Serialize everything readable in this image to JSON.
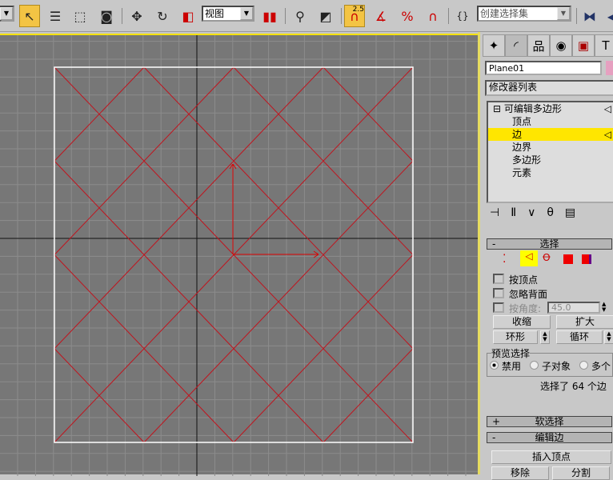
{
  "toolbar": {
    "view_select": "视图",
    "selection_set": "创建选择集",
    "snap_value": "2.5",
    "icons": [
      "dropdown-icon",
      "select-arrow-icon",
      "select-by-name-icon",
      "rect-selection-icon",
      "window-crossing-icon",
      "move-icon",
      "rotate-icon",
      "scale-icon",
      "pivot-icon",
      "manipulate-icon",
      "keyboard-shortcut-icon",
      "snap-icon",
      "angle-snap-icon",
      "percent-snap-icon",
      "spinner-snap-icon",
      "named-selection-icon",
      "mirror-icon",
      "align-icon"
    ]
  },
  "viewport": {
    "border_color": "#f5e200",
    "background": "#777777",
    "wire_color": "#c0141e"
  },
  "panel": {
    "tabs": [
      "create-icon",
      "modify-icon",
      "hierarchy-icon",
      "motion-icon",
      "display-icon",
      "utilities-icon"
    ],
    "object_name": "Plane01",
    "object_color": "#e6a0c0",
    "modifier_list": "修改器列表",
    "stack": {
      "root": "可编辑多边形",
      "items": [
        "顶点",
        "边",
        "边界",
        "多边形",
        "元素"
      ],
      "selected": 1
    },
    "selection": {
      "title": "选择",
      "by_vertex": "按顶点",
      "ignore_backfacing": "忽略背面",
      "by_angle": "按角度:",
      "angle_value": "45.0",
      "shrink": "收缩",
      "grow": "扩大",
      "ring": "环形",
      "loop": "循环",
      "preview_title": "预览选择",
      "preview_options": [
        "禁用",
        "子对象",
        "多个"
      ],
      "preview_selected": 0,
      "status": "选择了 64 个边"
    },
    "soft_selection": "软选择",
    "edit_edges": "编辑边",
    "insert_vertex": "插入顶点",
    "remove": "移除",
    "split": "分割"
  }
}
